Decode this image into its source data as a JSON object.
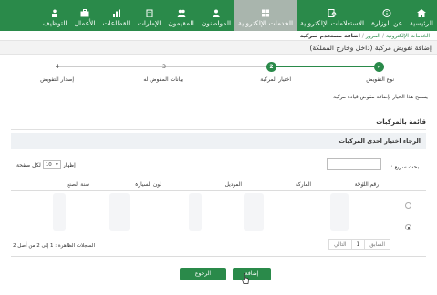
{
  "nav": {
    "items": [
      {
        "label": "الرئيسية",
        "icon": "home-icon"
      },
      {
        "label": "عن الوزارة",
        "icon": "info-icon"
      },
      {
        "label": "الاستعلامات الإلكترونية",
        "icon": "search-doc-icon"
      },
      {
        "label": "الخدمات الإلكترونية",
        "icon": "grid-icon",
        "active": true
      },
      {
        "label": "المواطنون",
        "icon": "user-icon"
      },
      {
        "label": "المقيمون",
        "icon": "users-icon"
      },
      {
        "label": "الإمارات",
        "icon": "building-icon"
      },
      {
        "label": "القطاعات",
        "icon": "sectors-icon"
      },
      {
        "label": "الأعمال",
        "icon": "briefcase-icon"
      },
      {
        "label": "التوظيف",
        "icon": "jobs-icon"
      }
    ]
  },
  "breadcrumb": {
    "items": [
      "الخدمات الإلكترونية",
      "المرور"
    ],
    "current": "اضافة مستخدم لمركبة"
  },
  "page": {
    "title": "إضافة تفويض مركبة (داخل وخارج المملكة)"
  },
  "steps": [
    {
      "number": "1",
      "label": "نوع التفويض",
      "state": "done"
    },
    {
      "number": "2",
      "label": "اختيار المركبة",
      "state": "active"
    },
    {
      "number": "3",
      "label": "بيانات المفوض له",
      "state": "pending"
    },
    {
      "number": "4",
      "label": "إصدار التفويض",
      "state": "pending"
    }
  ],
  "info_text": "يسمح هذا الخيار بإضافة مفوض قيادة مركبة",
  "section": {
    "title": "قائمة بالمركبات",
    "panel_title": "الرجاء اختيار احدى المركبات"
  },
  "search": {
    "label": "بحث سريع :",
    "value": ""
  },
  "length": {
    "prefix": "إظهار",
    "value": "10",
    "suffix": "لكل صفحة"
  },
  "table": {
    "columns": [
      "رقم اللوحة",
      "الماركة",
      "الموديل",
      "لون السيارة",
      "سنة الصنع"
    ],
    "rows": [
      {
        "selected": false
      },
      {
        "selected": true
      }
    ]
  },
  "footer": {
    "info": "السجلات الظاهرة : 1 إلى 2 من أصل 2",
    "pager": {
      "previous": "السابق",
      "current": "1",
      "next": "التالي"
    }
  },
  "buttons": {
    "add": "إضافة",
    "back": "الرجوع"
  },
  "colors": {
    "brand_green": "#2a8a4a",
    "nav_active": "#a9b5ad"
  }
}
